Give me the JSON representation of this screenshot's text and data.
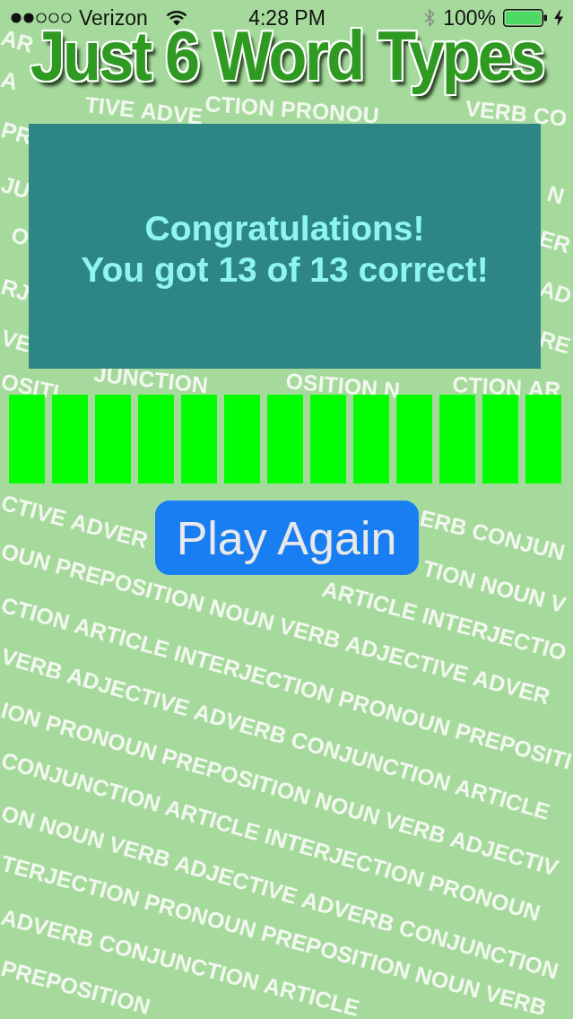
{
  "status_bar": {
    "carrier": "Verizon",
    "time": "4:28 PM",
    "battery": "100%"
  },
  "title": "Just 6 Word Types",
  "result_card": {
    "message": "Congratulations!\nYou got 13 of 13 correct!"
  },
  "answers": [
    {
      "correct": true
    },
    {
      "correct": true
    },
    {
      "correct": true
    },
    {
      "correct": true
    },
    {
      "correct": true
    },
    {
      "correct": true
    },
    {
      "correct": true
    },
    {
      "correct": true
    },
    {
      "correct": true
    },
    {
      "correct": true
    },
    {
      "correct": true
    },
    {
      "correct": true
    },
    {
      "correct": true
    }
  ],
  "play_again_button": {
    "label": "Play Again"
  },
  "background_text": [
    "AR",
    "A",
    "TIVE ADVE",
    "CTION PRONOU",
    "VERB CO",
    "PR",
    "JU",
    "N",
    "O",
    "ER",
    "RJ",
    "AD",
    "VE",
    "RE",
    "JUNCTION",
    "OSITION N",
    "OSITI",
    "CTION AR",
    "CTIVE ADVER",
    "ERB CONJUN",
    "OUN PREPOSITION NOUN VERB ADJECTIVE ADVER",
    "TION NOUN V",
    "ARTICLE INTERJECTIO",
    "CTION ARTICLE INTERJECTION PRONOUN PREPOSITI",
    "VERB ADJECTIVE ADVERB CONJUNCTION ARTICLE",
    "ION PRONOUN PREPOSITION NOUN VERB ADJECTIV",
    "CONJUNCTION ARTICLE INTERJECTION PRONOUN",
    "ON NOUN VERB ADJECTIVE ADVERB CONJUNCTION",
    "TERJECTION PRONOUN PREPOSITION NOUN VERB",
    "ADVERB CONJUNCTION ARTICLE",
    "PREPOSITION"
  ]
}
